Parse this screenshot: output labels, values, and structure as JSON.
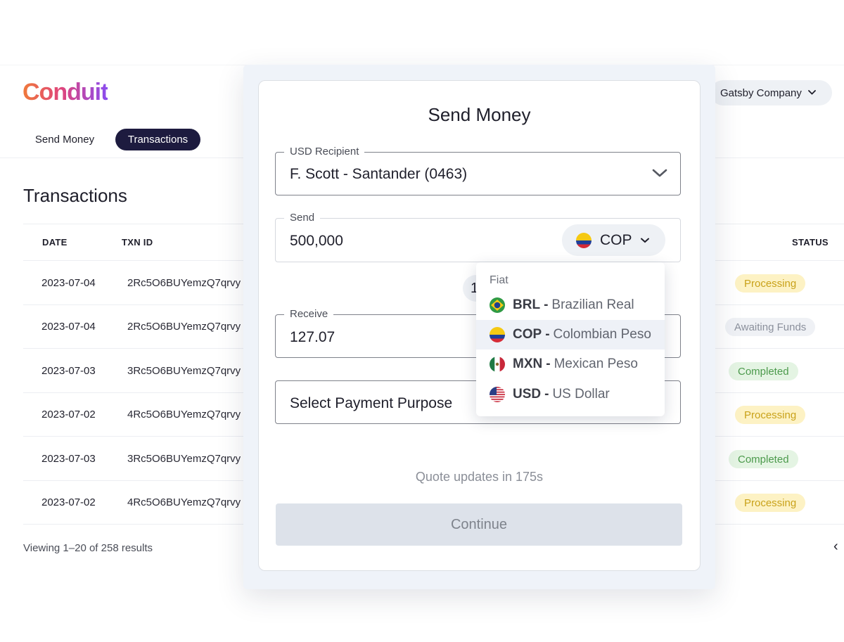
{
  "brand": {
    "logo_text": "Conduit"
  },
  "header": {
    "company_name": "Gatsby Company"
  },
  "nav": {
    "tabs": [
      {
        "label": "Send Money",
        "active": false
      },
      {
        "label": "Transactions",
        "active": true
      }
    ]
  },
  "page": {
    "title": "Transactions"
  },
  "table": {
    "headers": {
      "date": "DATE",
      "txn_id": "TXN ID",
      "status": "STATUS"
    },
    "rows": [
      {
        "date": "2023-07-04",
        "txn_id": "2Rc5O6BUYemzQ7qrvy",
        "status": "Processing"
      },
      {
        "date": "2023-07-04",
        "txn_id": "2Rc5O6BUYemzQ7qrvy",
        "status": "Awaiting Funds"
      },
      {
        "date": "2023-07-03",
        "txn_id": "3Rc5O6BUYemzQ7qrvy",
        "status": "Completed"
      },
      {
        "date": "2023-07-02",
        "txn_id": "4Rc5O6BUYemzQ7qrvy",
        "status": "Processing"
      },
      {
        "date": "2023-07-03",
        "txn_id": "3Rc5O6BUYemzQ7qrvy",
        "status": "Completed"
      },
      {
        "date": "2023-07-02",
        "txn_id": "4Rc5O6BUYemzQ7qrvy",
        "status": "Processing"
      }
    ]
  },
  "pagination": {
    "viewing_text": "Viewing 1–20 of 258 results",
    "prev_glyph": "‹"
  },
  "modal": {
    "title": "Send Money",
    "recipient": {
      "label": "USD Recipient",
      "value": "F. Scott - Santander (0463)"
    },
    "send": {
      "label": "Send",
      "value": "500,000",
      "currency": "COP"
    },
    "rate_partial": "1",
    "receive": {
      "label": "Receive",
      "value": "127.07"
    },
    "purpose": {
      "placeholder": "Select Payment Purpose"
    },
    "quote_text": "Quote updates in 175s",
    "continue_label": "Continue"
  },
  "currency_dropdown": {
    "heading": "Fiat",
    "options": [
      {
        "code": "BRL",
        "separator": "-",
        "name": "Brazilian Real",
        "selected": false
      },
      {
        "code": "COP",
        "separator": "-",
        "name": "Colombian Peso",
        "selected": true
      },
      {
        "code": "MXN",
        "separator": "-",
        "name": "Mexican Peso",
        "selected": false
      },
      {
        "code": "USD",
        "separator": "-",
        "name": "US Dollar",
        "selected": false
      }
    ]
  },
  "colors": {
    "nav_active_bg": "#1d1b3f",
    "processing_bg": "#fdf2c4",
    "processing_fg": "#c9a21a",
    "awaiting_bg": "#eff1f5",
    "awaiting_fg": "#8b909c",
    "completed_bg": "#e4f4e3",
    "completed_fg": "#4c9a4c",
    "continue_disabled_bg": "#dde2ea"
  },
  "icons": {
    "recipient_chevron": "chevron-down-icon",
    "currency_chevron": "chevron-down-icon",
    "company_chevron": "chevron-down-icon",
    "flags": [
      "brazil-flag-icon",
      "colombia-flag-icon",
      "mexico-flag-icon",
      "usa-flag-icon"
    ]
  }
}
